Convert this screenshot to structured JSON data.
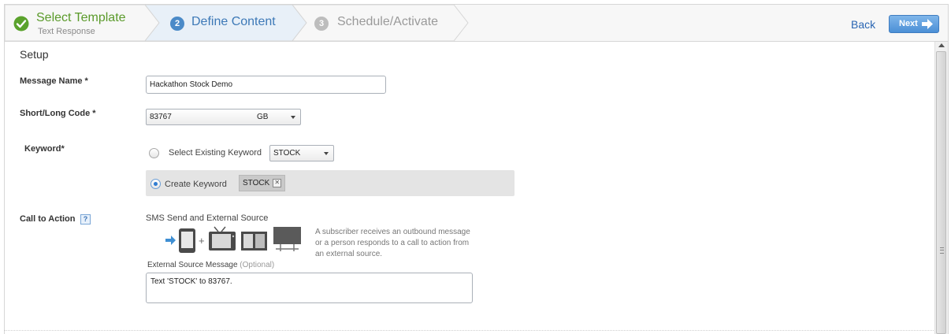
{
  "wizard": {
    "steps": [
      {
        "number": "",
        "title": "Select Template",
        "subtitle": "Text Response",
        "state": "complete"
      },
      {
        "number": "2",
        "title": "Define Content",
        "state": "active"
      },
      {
        "number": "3",
        "title": "Schedule/Activate",
        "state": "upcoming"
      }
    ],
    "back_label": "Back",
    "next_label": "Next"
  },
  "setup": {
    "title": "Setup",
    "message_name": {
      "label": "Message Name *",
      "value": "Hackathon Stock Demo"
    },
    "short_long_code": {
      "label": "Short/Long Code *",
      "value": "83767",
      "country": "GB"
    },
    "keyword": {
      "label": "Keyword*",
      "existing_label": "Select Existing Keyword",
      "existing_value": "STOCK",
      "create_label": "Create Keyword",
      "create_value": "STOCK",
      "selected": "create"
    },
    "call_to_action": {
      "label": "Call to Action",
      "help": "?",
      "type_label": "SMS Send and External Source",
      "description": "A subscriber receives an outbound message or a person responds to a call to action from an external source.",
      "external_label": "External Source Message",
      "optional_label": "(Optional)",
      "external_value": "Text 'STOCK' to 83767."
    }
  },
  "colors": {
    "complete": "#5a9a2a",
    "active": "#3d79b7",
    "upcoming": "#9a9a9a",
    "next_button": "#4b8fd6"
  }
}
